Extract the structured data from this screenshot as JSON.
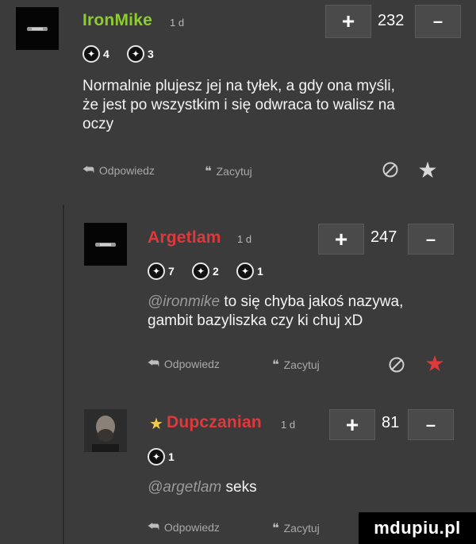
{
  "comments": [
    {
      "nick": "IronMike",
      "time": "1 d",
      "score": "232",
      "badges": [
        {
          "icon": "trophy-icon",
          "count": "4"
        },
        {
          "icon": "medal-icon",
          "count": "3"
        }
      ],
      "text_lines": [
        "Normalnie plujesz jej na tyłek, a gdy ona myśli,",
        "że jest po wszystkim i się odwraca to walisz na",
        "oczy"
      ],
      "reply_label": "Odpowiedz",
      "quote_label": "Zacytuj"
    },
    {
      "nick": "Argetlam",
      "time": "1 d",
      "score": "247",
      "badges": [
        {
          "icon": "trophy-icon",
          "count": "7"
        },
        {
          "icon": "medal-icon",
          "count": "2"
        },
        {
          "icon": "medal-dark-icon",
          "count": "1"
        }
      ],
      "mention": "@ironmike",
      "text_line1": " to się chyba jakoś nazywa,",
      "text_line2": "gambit bazyliszka czy ki chuj xD",
      "reply_label": "Odpowiedz",
      "quote_label": "Zacytuj"
    },
    {
      "nick": "Dupczanian",
      "time": "1 d",
      "score": "81",
      "badges": [
        {
          "icon": "trophy-icon",
          "count": "1"
        }
      ],
      "mention": "@argetlam",
      "text": " seks",
      "reply_label": "Odpowiedz",
      "quote_label": "Zacytuj"
    }
  ],
  "vote": {
    "plus": "+",
    "minus": "–"
  },
  "watermark": "mdupiu.pl",
  "colors": {
    "green_nick": "#8ccd2b",
    "red_nick": "#e0383b",
    "star_red": "#e0383b",
    "background": "#3b3b3b"
  }
}
